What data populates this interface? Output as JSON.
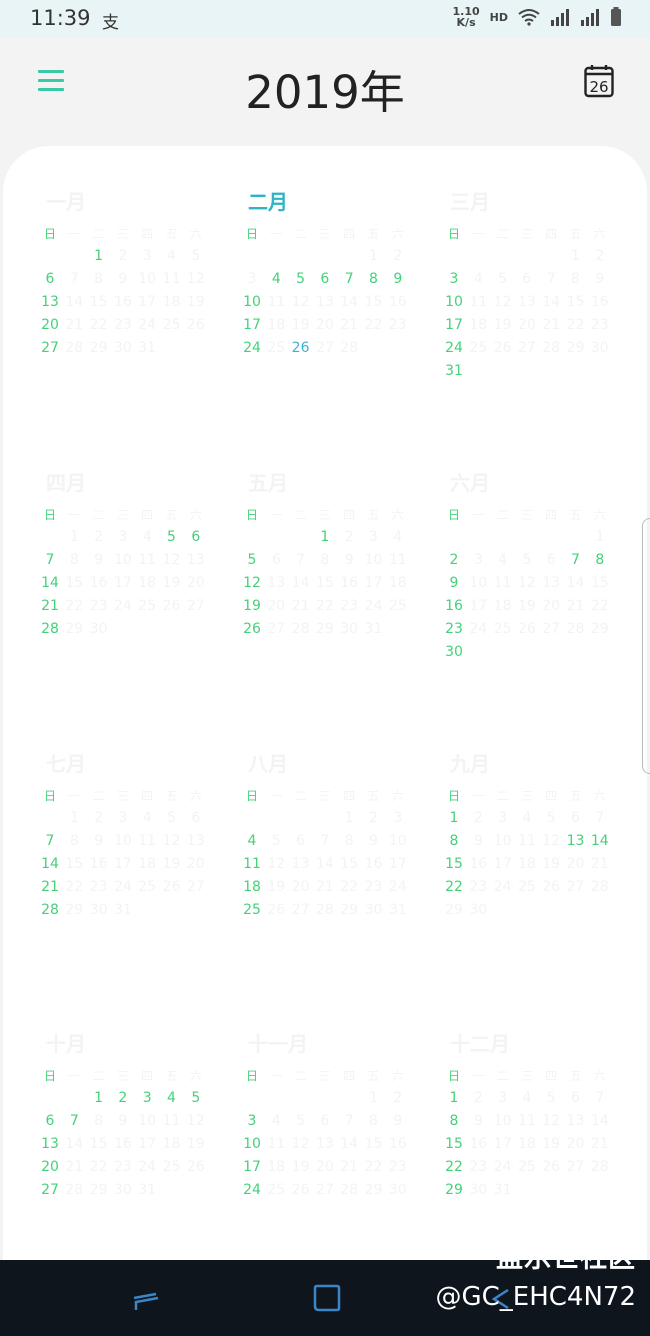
{
  "status": {
    "time": "11:39",
    "app_icon": "支",
    "net_speed_value": "1.10",
    "net_speed_unit": "K/s",
    "hd": "HD"
  },
  "header": {
    "year_title": "2019年",
    "today_day": "26"
  },
  "colors": {
    "accent": "#3bc9a5",
    "weekend": "#45d17a",
    "faint": "#f1f4f2",
    "title_teal": "#2bb5c8",
    "today": "#3ab3d9"
  },
  "weekdays": [
    "日",
    "一",
    "二",
    "三",
    "四",
    "五",
    "六"
  ],
  "months": [
    {
      "title": "一月",
      "first_weekday": 2,
      "days": 31
    },
    {
      "title": "二月",
      "first_weekday": 5,
      "days": 28,
      "current": true
    },
    {
      "title": "三月",
      "first_weekday": 5,
      "days": 31
    },
    {
      "title": "四月",
      "first_weekday": 1,
      "days": 30
    },
    {
      "title": "五月",
      "first_weekday": 3,
      "days": 31
    },
    {
      "title": "六月",
      "first_weekday": 6,
      "days": 30
    },
    {
      "title": "七月",
      "first_weekday": 1,
      "days": 31
    },
    {
      "title": "八月",
      "first_weekday": 4,
      "days": 31
    },
    {
      "title": "九月",
      "first_weekday": 0,
      "days": 30
    },
    {
      "title": "十月",
      "first_weekday": 2,
      "days": 31
    },
    {
      "title": "十一月",
      "first_weekday": 5,
      "days": 30
    },
    {
      "title": "十二月",
      "first_weekday": 0,
      "days": 31
    }
  ],
  "today": {
    "month_index": 1,
    "day": 26
  },
  "highlights": [
    {
      "month_index": 0,
      "days": [
        1,
        6,
        13,
        20,
        27
      ]
    },
    {
      "month_index": 1,
      "days": [
        4,
        5,
        6,
        7,
        8,
        9,
        10,
        17,
        24
      ]
    },
    {
      "month_index": 2,
      "days": [
        3,
        10,
        17,
        24,
        31
      ]
    },
    {
      "month_index": 3,
      "days": [
        5,
        6,
        7,
        14,
        21,
        28
      ]
    },
    {
      "month_index": 4,
      "days": [
        1,
        5,
        12,
        19,
        26
      ]
    },
    {
      "month_index": 5,
      "days": [
        2,
        7,
        8,
        9,
        16,
        23,
        30
      ]
    },
    {
      "month_index": 6,
      "days": [
        7,
        14,
        21,
        28
      ]
    },
    {
      "month_index": 7,
      "days": [
        4,
        11,
        18,
        25
      ]
    },
    {
      "month_index": 8,
      "days": [
        1,
        8,
        13,
        14,
        15,
        22
      ]
    },
    {
      "month_index": 9,
      "days": [
        1,
        2,
        3,
        4,
        5,
        6,
        7,
        13,
        20,
        27
      ]
    },
    {
      "month_index": 10,
      "days": [
        3,
        10,
        17,
        24
      ]
    },
    {
      "month_index": 11,
      "days": [
        1,
        8,
        15,
        22,
        29
      ]
    }
  ],
  "watermark": {
    "line1": "盖乐世社区",
    "line2": "@GC_EHC4N72"
  }
}
